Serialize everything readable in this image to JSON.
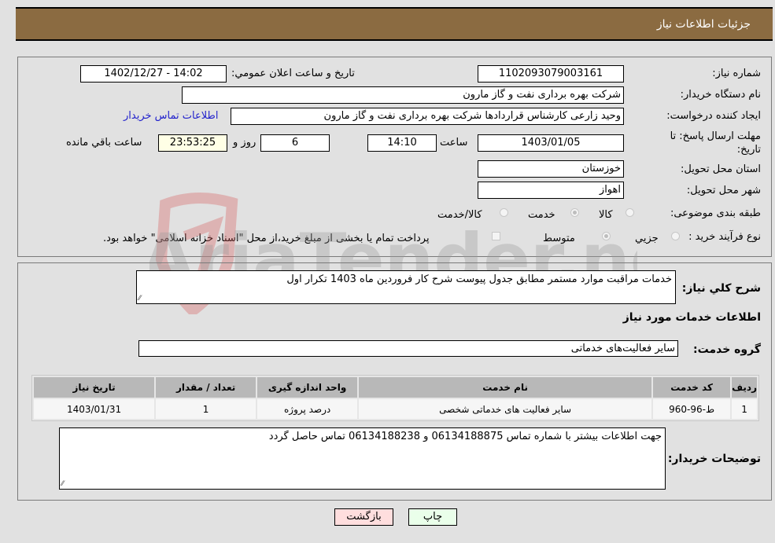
{
  "header": {
    "title": "جزئیات اطلاعات نیاز"
  },
  "form": {
    "need_number": {
      "label": "شماره نیاز:",
      "value": "1102093079003161"
    },
    "announce_datetime": {
      "label": "تاریخ و ساعت اعلان عمومي:",
      "value": "1402/12/27 - 14:02"
    },
    "buyer_org": {
      "label": "نام دستگاه خریدار:",
      "value": "شرکت بهره برداری نفت و گاز مارون"
    },
    "requester": {
      "label": "ایجاد کننده درخواست:",
      "value": "وحید زارعی کارشناس قراردادها شرکت بهره برداری نفت و گاز مارون"
    },
    "buyer_contact_link": "اطلاعات تماس خریدار",
    "deadline": {
      "label_line1": "مهلت ارسال پاسخ: تا",
      "label_line2": "تاریخ:",
      "date": "1403/01/05",
      "time_label": "ساعت",
      "time": "14:10",
      "days": "6",
      "days_label": "روز و",
      "remaining": "23:53:25",
      "remaining_label": "ساعت باقي مانده"
    },
    "province": {
      "label": "استان محل تحویل:",
      "value": "خوزستان"
    },
    "city": {
      "label": "شهر محل تحویل:",
      "value": "اهواز"
    },
    "category": {
      "label": "طبقه بندی موضوعی:",
      "options": [
        {
          "label": "کالا",
          "checked": false
        },
        {
          "label": "خدمت",
          "checked": true
        },
        {
          "label": "کالا/خدمت",
          "checked": false
        }
      ]
    },
    "purchase_type": {
      "label": "نوع فرآیند خرید :",
      "options": [
        {
          "label": "جزيي",
          "checked": false
        },
        {
          "label": "متوسط",
          "checked": true
        }
      ],
      "treasury_note": "پرداخت تمام یا بخشی از مبلغ خرید،از محل \"اسناد خزانه اسلامی\" خواهد بود."
    }
  },
  "details": {
    "general_desc_label": "شرح كلي نياز:",
    "general_desc": "خدمات  مراقبت موارد مستمر مطابق جدول پیوست شرح کار فروردین ماه 1403 تکرار اول",
    "services_heading": "اطلاعات خدمات مورد نیاز",
    "service_group_label": "گروه خدمت:",
    "service_group": "سایر فعالیت‌های خدماتی",
    "table": {
      "headers": [
        "ردیف",
        "کد خدمت",
        "نام خدمت",
        "واحد اندازه گیری",
        "تعداد / مقدار",
        "تاریخ نیاز"
      ],
      "rows": [
        [
          "1",
          "ط-96-960",
          "سایر فعالیت های خدماتی شخصی",
          "درصد پروژه",
          "1",
          "1403/01/31"
        ]
      ]
    },
    "buyer_notes_label": "توضیحات خریدار:",
    "buyer_notes": "جهت اطلاعات بیشتر با شماره تماس 06134188875 و 06134188238 تماس حاصل گردد"
  },
  "buttons": {
    "print": "چاپ",
    "back": "بازگشت"
  },
  "watermark": {
    "text": "AriaTender.neT"
  },
  "colors": {
    "header_bg": "#8b6b41",
    "print_bg": "#eaffea",
    "back_bg": "#ffdede",
    "remaining_bg": "#ffffe6",
    "link": "#2222cc"
  }
}
